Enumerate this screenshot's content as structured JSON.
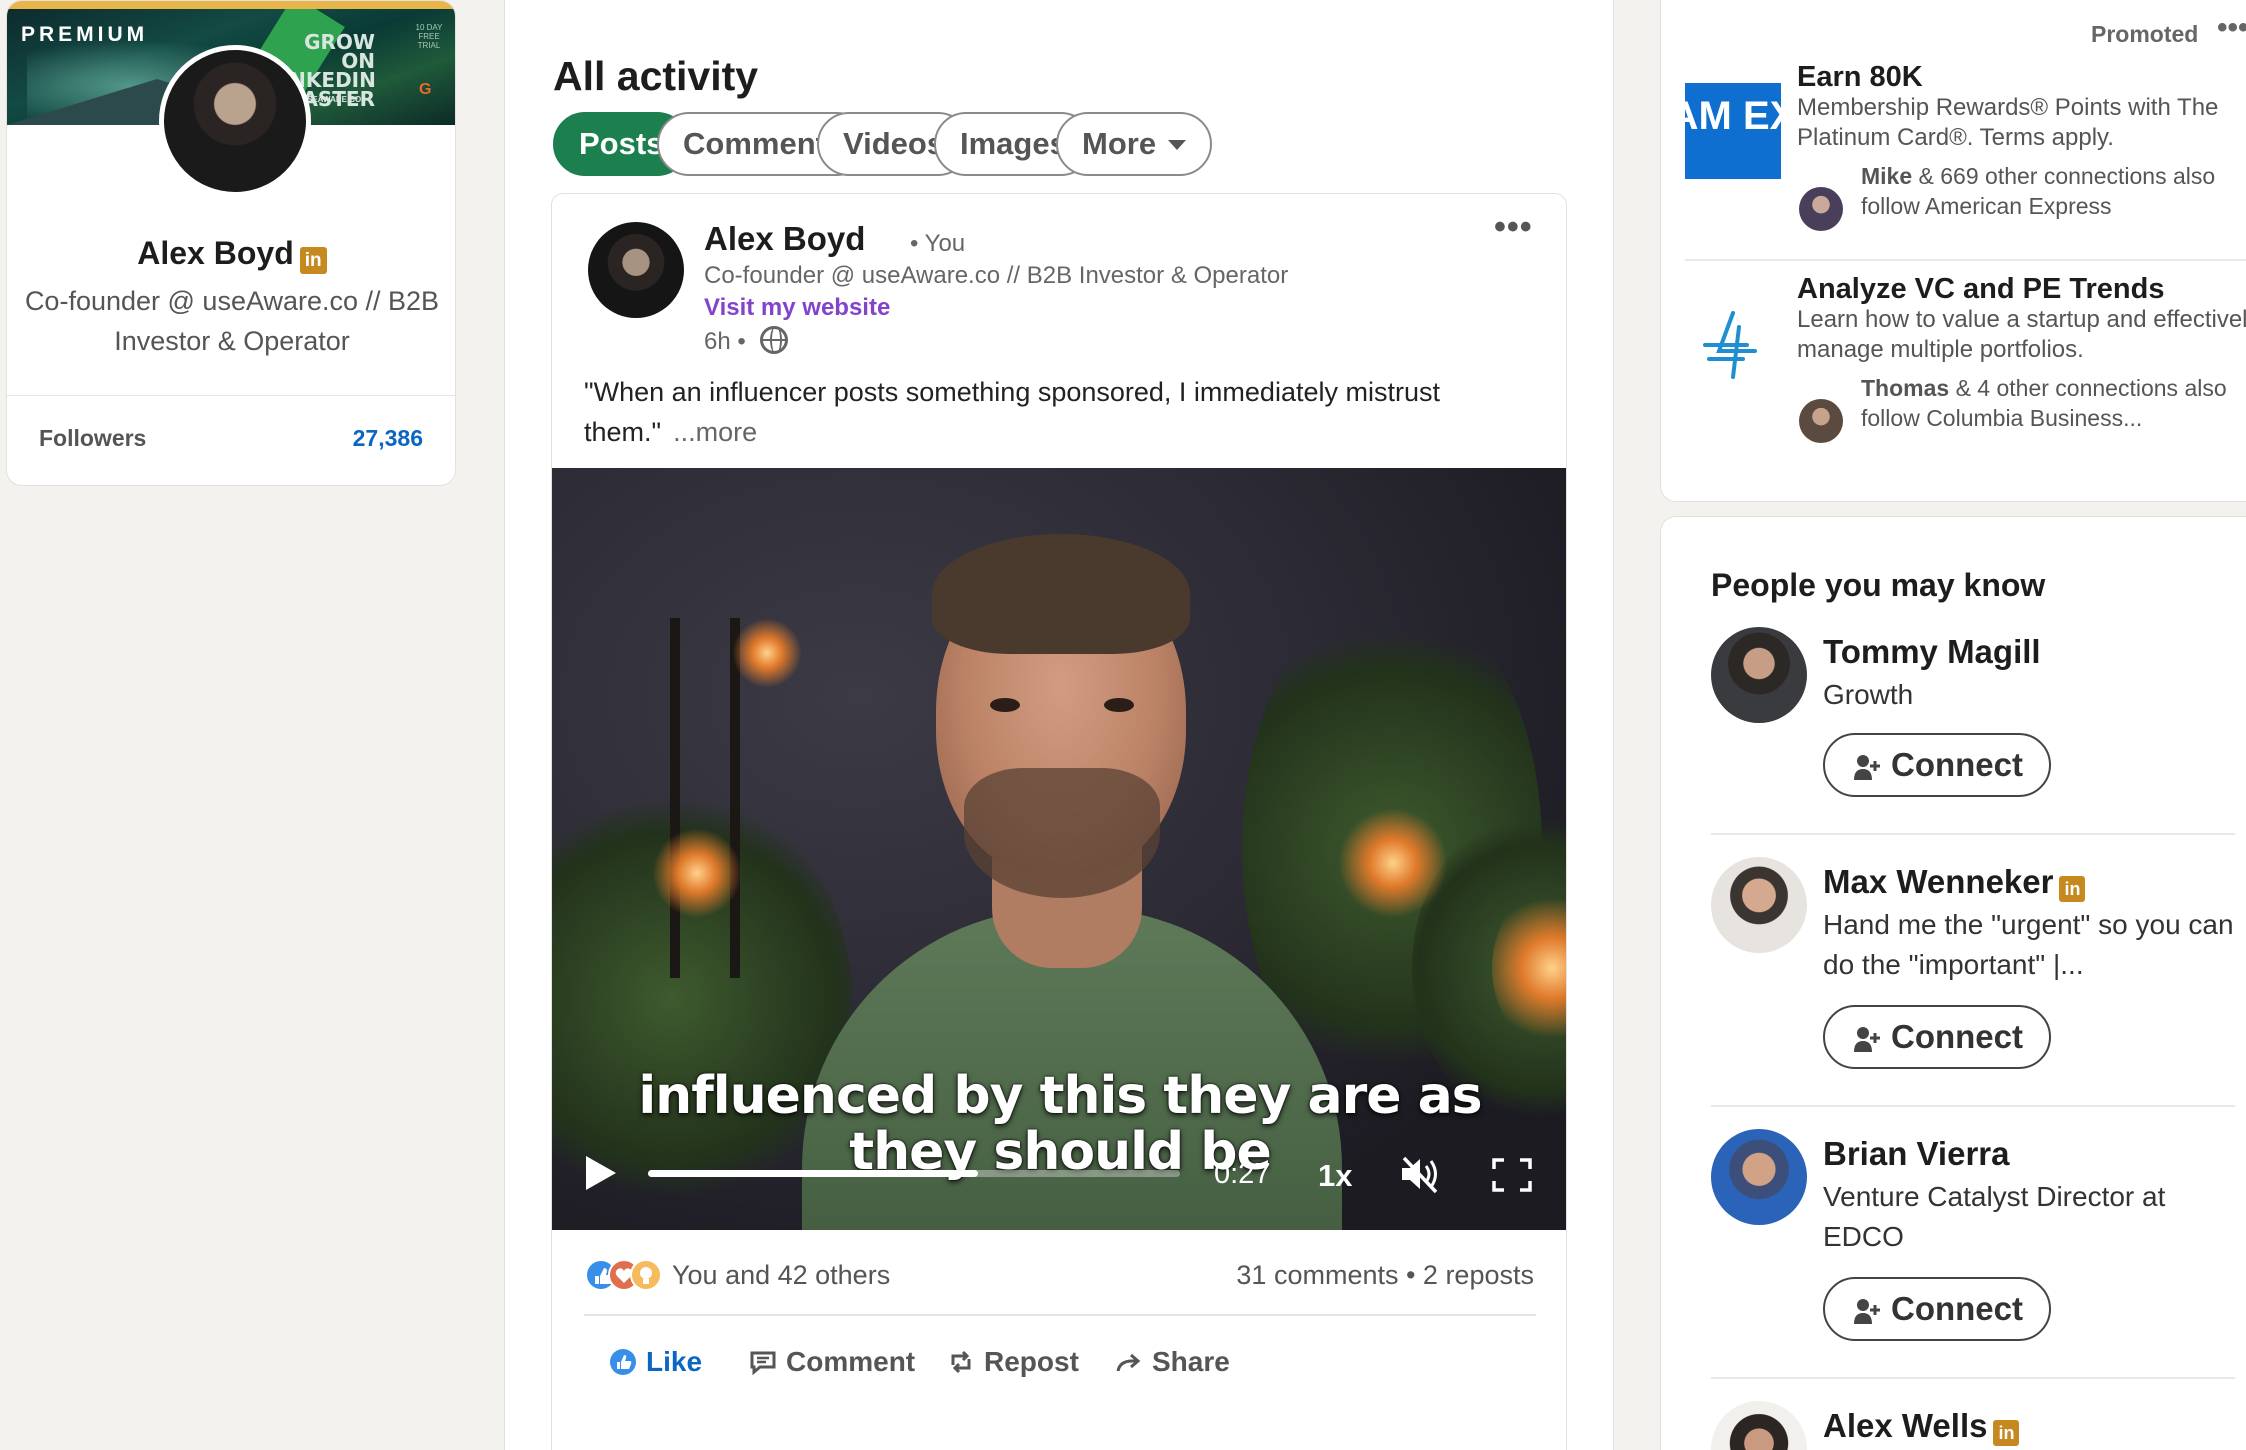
{
  "profile": {
    "banner": {
      "premium_label": "PREMIUM",
      "grow_text": "GROW ON LINKEDIN FASTER",
      "site_text": "SEAWARE.CO",
      "trial_badge": "10 DAY FREE TRIAL"
    },
    "name": "Alex Boyd",
    "linkedin_badge": "in",
    "headline": "Co-founder @ useAware.co // B2B Investor & Operator",
    "followers_label": "Followers",
    "followers_count": "27,386"
  },
  "activity": {
    "title": "All activity",
    "filters": [
      {
        "label": "Posts",
        "active": true
      },
      {
        "label": "Comments",
        "active": false
      },
      {
        "label": "Videos",
        "active": false
      },
      {
        "label": "Images",
        "active": false
      },
      {
        "label": "More",
        "active": false
      }
    ],
    "post": {
      "author": "Alex Boyd",
      "author_tag": "• You",
      "headline": "Co-founder @ useAware.co // B2B Investor & Operator",
      "link_text": "Visit my website",
      "time": "6h •",
      "menu": "•••",
      "text": "\"When an influencer posts something sponsored, I immediately mistrust them.\"",
      "see_more": "...more",
      "video": {
        "subtitle_line1": "influenced by this they are as",
        "subtitle_line2": "they should be",
        "time": "0:27",
        "speed": "1x",
        "progress": 0.62,
        "muted": true
      },
      "reactions_text": "You and 42 others",
      "comments_reposts": "31 comments • 2 reposts",
      "actions": {
        "like": "Like",
        "comment": "Comment",
        "repost": "Repost",
        "share": "Share"
      }
    }
  },
  "ads": {
    "promoted_label": "Promoted",
    "menu": "•••",
    "items": [
      {
        "logo_text": "AM EX",
        "title": "Earn 80K",
        "description": "Membership Rewards® Points with The Platinum Card®. Terms apply.",
        "social_name": "Mike",
        "social_text": " & 669 other connections also follow American Express"
      },
      {
        "title": "Analyze VC and PE Trends",
        "description": "Learn how to value a startup and effectively manage multiple portfolios.",
        "social_name": "Thomas",
        "social_text": " & 4 other connections also follow Columbia Business..."
      }
    ]
  },
  "pymk": {
    "title": "People you may know",
    "connect_label": "Connect",
    "people": [
      {
        "name": "Tommy Magill",
        "description": "Growth",
        "badge": false
      },
      {
        "name": "Max Wenneker",
        "description": "Hand me the \"urgent\" so you can do the \"important\" |...",
        "badge": true
      },
      {
        "name": "Brian Vierra",
        "description": "Venture Catalyst Director at EDCO",
        "badge": false
      },
      {
        "name": "Alex Wells",
        "description": "",
        "badge": true
      }
    ]
  },
  "colors": {
    "accent_green": "#1b7f4e",
    "link_blue": "#0a66c2",
    "link_purple": "#8344cc",
    "premium_gold": "#c5891f",
    "amex_blue": "#0f6fd1"
  }
}
